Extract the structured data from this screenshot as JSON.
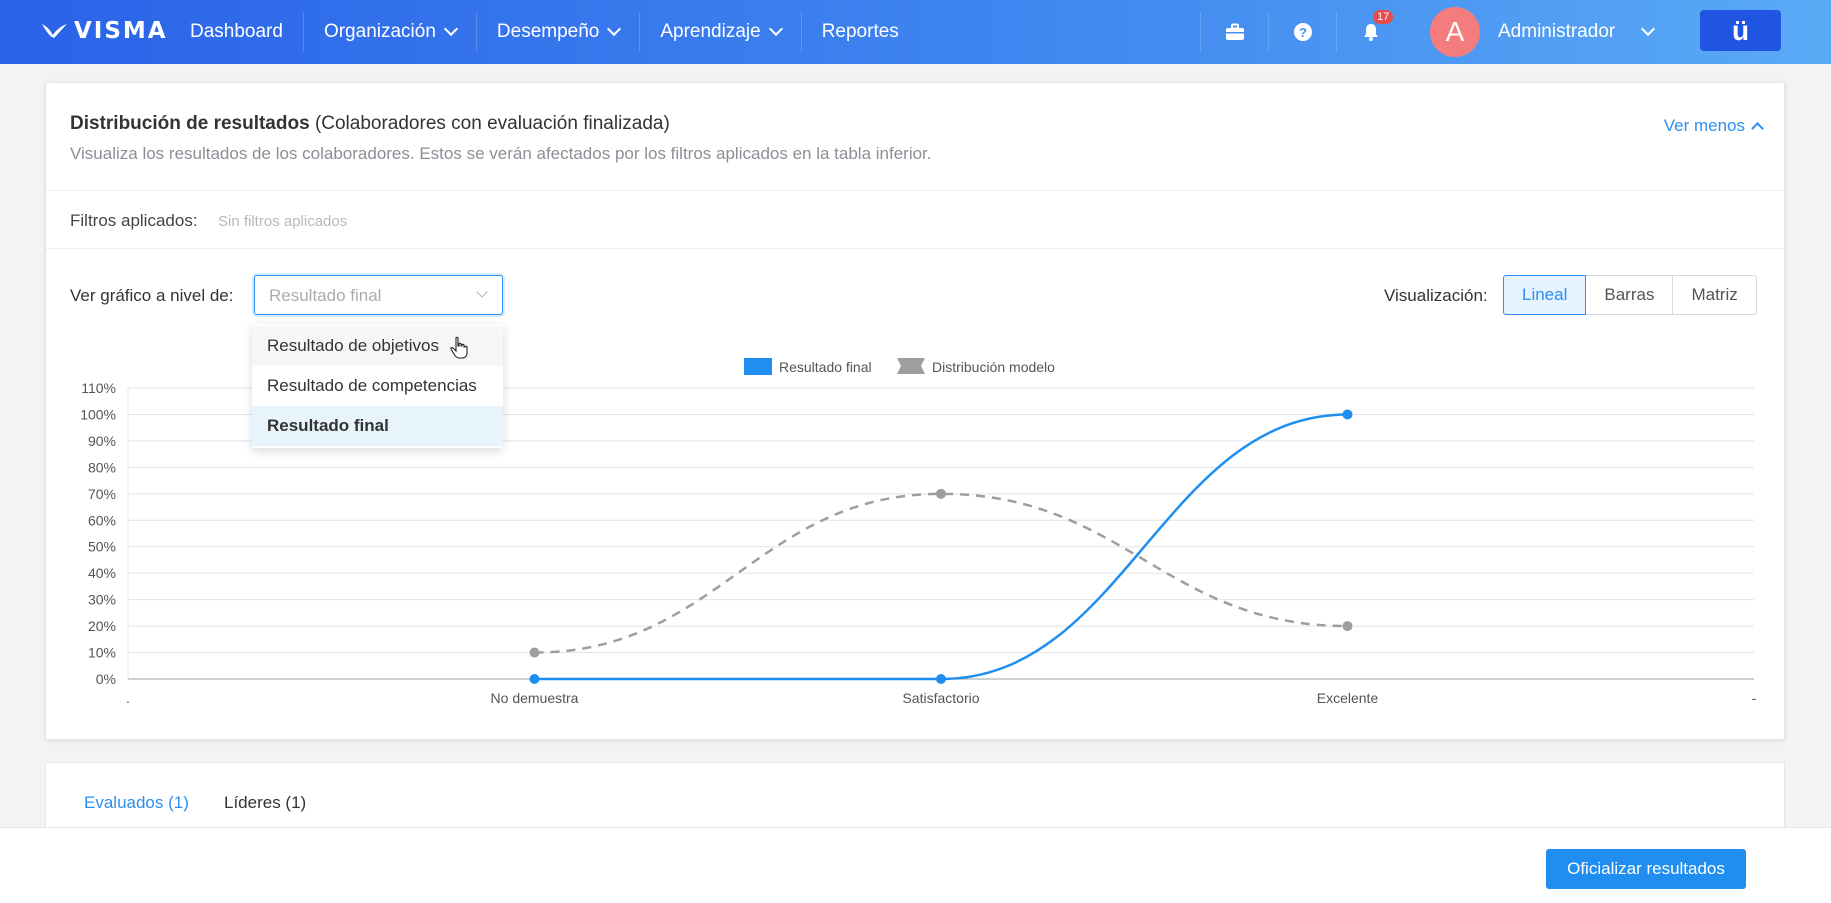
{
  "nav": {
    "logo": "VISMA",
    "items": [
      {
        "label": "Dashboard",
        "dropdown": false
      },
      {
        "label": "Organización",
        "dropdown": true
      },
      {
        "label": "Desempeño",
        "dropdown": true
      },
      {
        "label": "Aprendizaje",
        "dropdown": true
      },
      {
        "label": "Reportes",
        "dropdown": false
      }
    ],
    "notifications_count": "17",
    "user": {
      "initial": "A",
      "name": "Administrador"
    },
    "app_button": "ü"
  },
  "panel": {
    "title_bold": "Distribución de resultados",
    "title_rest": "(Colaboradores con evaluación finalizada)",
    "subtitle": "Visualiza los resultados de los colaboradores. Estos se verán afectados por los filtros aplicados en la tabla inferior.",
    "toggle_label": "Ver menos",
    "filters_label": "Filtros aplicados:",
    "filters_value": "Sin filtros aplicados",
    "level_label": "Ver gráfico a nivel de:",
    "level_placeholder": "Resultado final",
    "level_options": [
      "Resultado de objetivos",
      "Resultado de competencias",
      "Resultado final"
    ],
    "visualization_label": "Visualización:",
    "visualization_options": [
      "Lineal",
      "Barras",
      "Matriz"
    ],
    "visualization_active": "Lineal"
  },
  "chart_data": {
    "type": "line",
    "categories": [
      "No demuestra",
      "Satisfactorio",
      "Excelente"
    ],
    "x_tick_labels": [
      ".",
      "No demuestra",
      "Satisfactorio",
      "Excelente",
      "-"
    ],
    "y_ticks": [
      "0%",
      "10%",
      "20%",
      "30%",
      "40%",
      "50%",
      "60%",
      "70%",
      "80%",
      "90%",
      "100%",
      "110%"
    ],
    "ylim": [
      0,
      110
    ],
    "grid": true,
    "legend_position": "top",
    "series": [
      {
        "name": "Resultado final",
        "values": [
          0,
          0,
          100
        ],
        "color": "#1f8ef0",
        "style": "solid"
      },
      {
        "name": "Distribución modelo",
        "values": [
          10,
          70,
          20
        ],
        "color": "#9e9e9e",
        "style": "dashed"
      }
    ]
  },
  "tabs": [
    {
      "label": "Evaluados (1)",
      "active": true
    },
    {
      "label": "Líderes (1)",
      "active": false
    }
  ],
  "footer": {
    "primary_button": "Oficializar resultados"
  }
}
